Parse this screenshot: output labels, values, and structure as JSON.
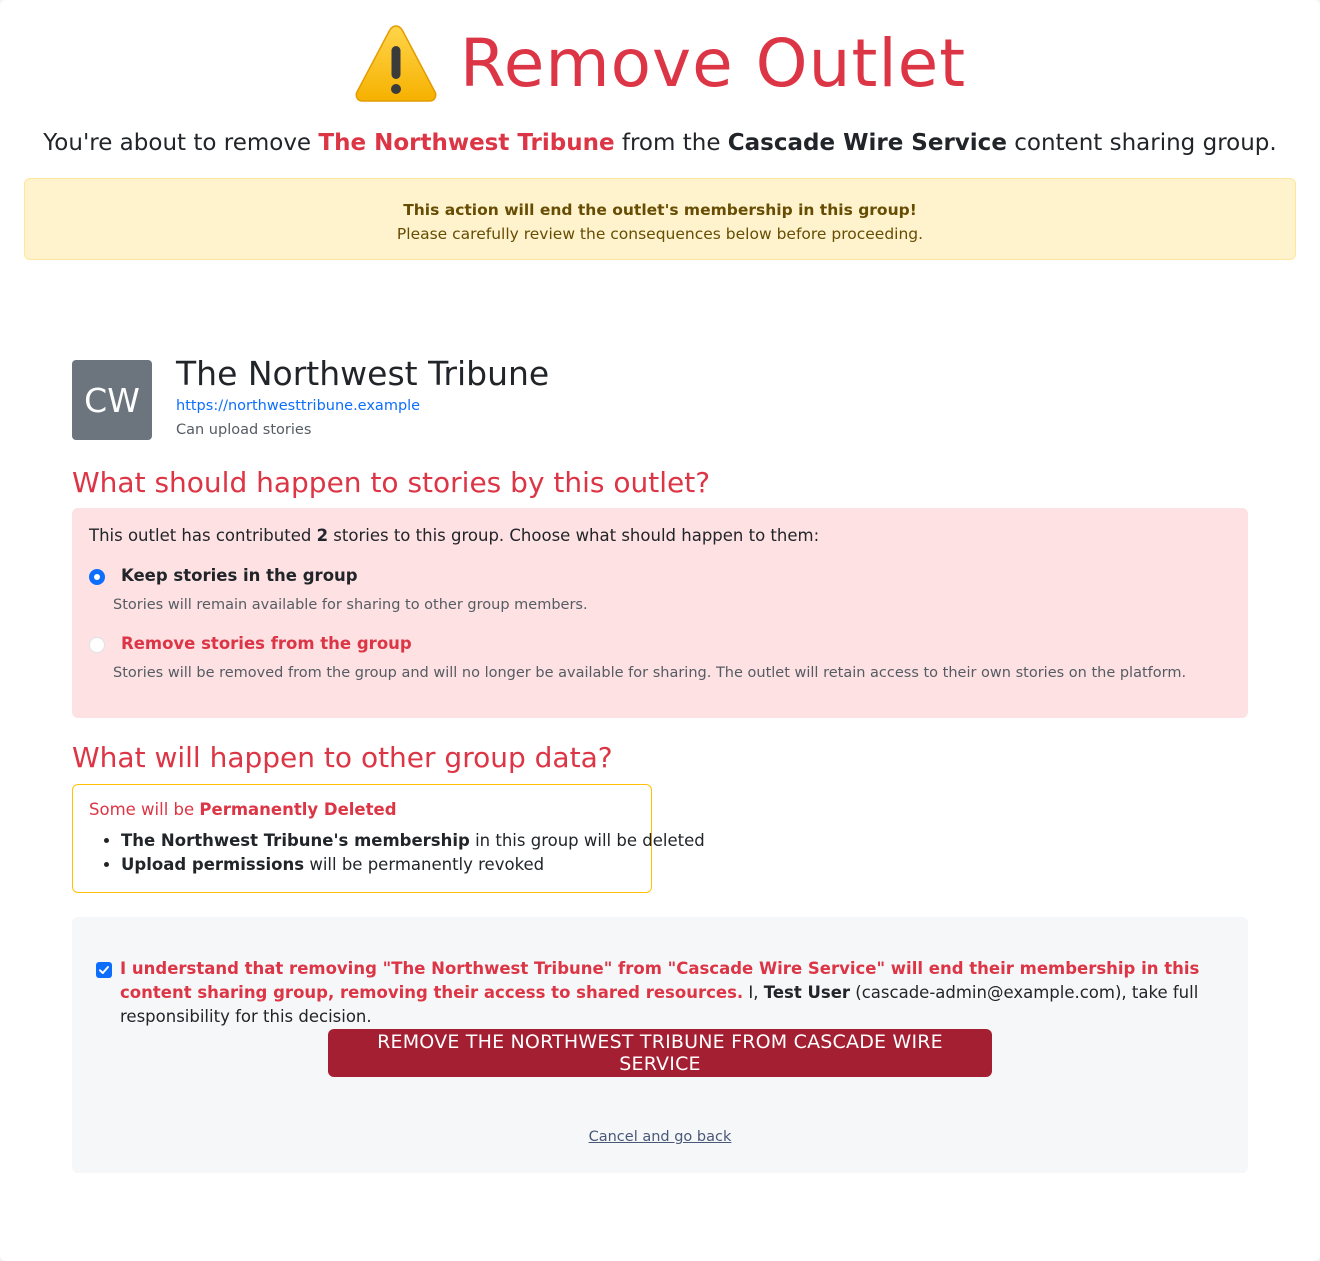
{
  "header": {
    "icon": "warning-icon",
    "title": "Remove Outlet",
    "subtitle_prefix": "You're about to remove ",
    "subtitle_outlet": "The Northwest Tribune",
    "subtitle_middle": " from the ",
    "subtitle_group": "Cascade Wire Service",
    "subtitle_suffix": " content sharing group."
  },
  "alert": {
    "headline": "This action will end the outlet's membership in this group!",
    "body": "Please carefully review the consequences below before proceeding."
  },
  "outlet": {
    "avatar_initials": "CW",
    "name": "The Northwest Tribune",
    "url": "https://northwesttribune.example",
    "permission": "Can upload stories"
  },
  "stories": {
    "heading": "What should happen to stories by this outlet?",
    "intro_prefix": "This outlet has contributed ",
    "count": "2",
    "intro_suffix": " stories to this group. Choose what should happen to them:",
    "options": [
      {
        "label": "Keep stories in the group",
        "description": "Stories will remain available for sharing to other group members.",
        "selected": true
      },
      {
        "label": "Remove stories from the group",
        "description": "Stories will be removed from the group and will no longer be available for sharing. The outlet will retain access to their own stories on the platform.",
        "selected": false
      }
    ]
  },
  "group_data": {
    "heading": "What will happen to other group data?",
    "lead_prefix": "Some will be ",
    "lead_strong": "Permanently Deleted",
    "items": [
      {
        "strong": "The Northwest Tribune's membership",
        "rest": " in this group will be deleted"
      },
      {
        "strong": "Upload permissions",
        "rest": " will be permanently revoked"
      }
    ]
  },
  "confirm": {
    "checked": true,
    "danger_text": "I understand that removing \"The Northwest Tribune\" from \"Cascade Wire Service\" will end their membership in this content sharing group, removing their access to shared resources.",
    "mid": " I, ",
    "user": "Test User",
    "rest": " (cascade-admin@example.com), take full responsibility for this decision.",
    "button_label": "REMOVE THE NORTHWEST TRIBUNE FROM CASCADE WIRE SERVICE",
    "cancel_label": "Cancel and go back"
  },
  "colors": {
    "danger": "#dc3545",
    "button": "#a51f33",
    "primary": "#0d6efd",
    "warning_bg": "#fff3cd"
  }
}
